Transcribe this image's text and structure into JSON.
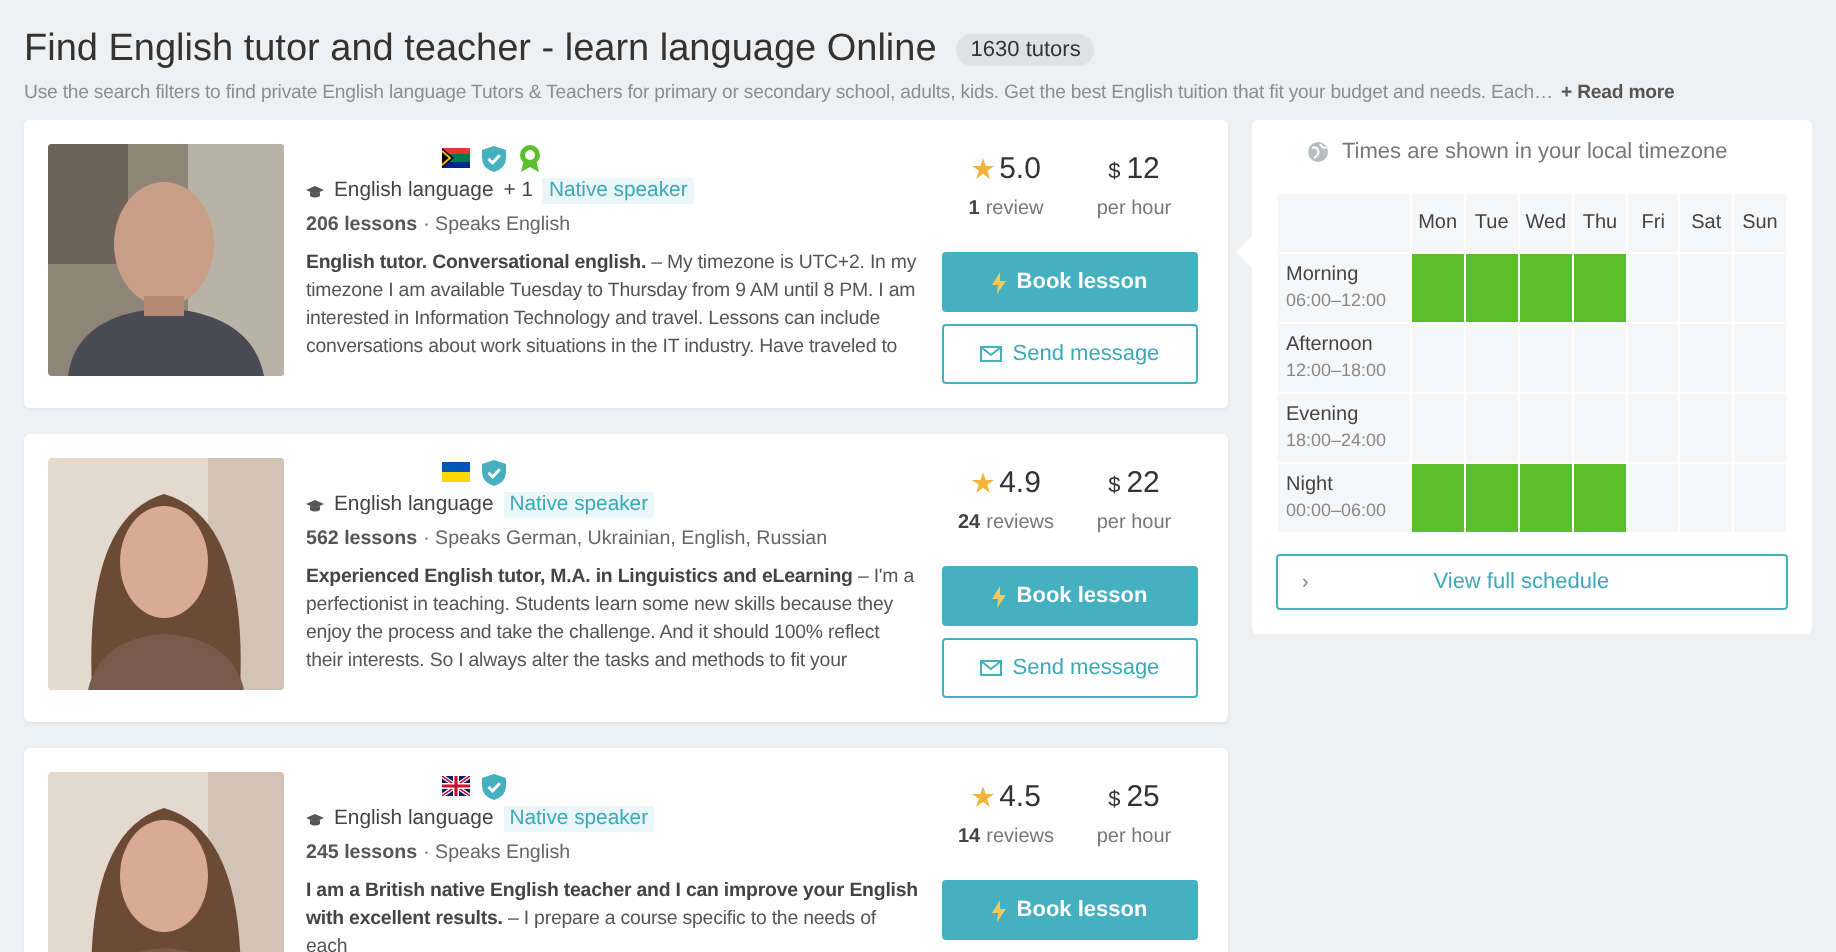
{
  "header": {
    "title": "Find English tutor and teacher - learn language Online",
    "count": "1630 tutors",
    "description": "Use the search filters to find private English language Tutors & Teachers for primary or secondary school, adults, kids. Get the best English tuition that fit your budget and needs. Each…",
    "read_more": "+ Read more"
  },
  "tutors": [
    {
      "photo": {
        "kind": "picture"
      },
      "badges": [
        {
          "kind": "flag_za"
        },
        {
          "kind": "verified"
        },
        {
          "kind": "award"
        }
      ],
      "language": "English language",
      "extra_languages": "+ 1",
      "native": "Native speaker",
      "lessons": "206 lessons",
      "speaks": "· Speaks English",
      "description": "**English tutor. Conversational english.** – My timezone is UTC+2. In my timezone I am available Tuesday to Thursday from 9 AM until 8 PM. I am interested in Information Technology and travel. Lessons can include conversations about work situations in the IT industry. Have traveled to",
      "rating": "5.0",
      "reviews_count": "1",
      "reviews_label": "review",
      "currency": "$",
      "price": "12",
      "price_unit": "per hour",
      "book": "Book lesson",
      "message": "Send message"
    },
    {
      "photo": {
        "kind": "picture"
      },
      "badges": [
        {
          "kind": "flag_ua"
        },
        {
          "kind": "verified"
        }
      ],
      "language": "English language",
      "native": "Native speaker",
      "lessons": "562 lessons",
      "speaks": "· Speaks German, Ukrainian, English, Russian",
      "description": "**Experienced English tutor, M.A. in Linguistics and eLearning** – I'm a perfectionist in teaching. Students learn some new skills because they enjoy the process and take the challenge. And it should 100% reflect their interests. So I always alter the tasks and methods to fit your",
      "rating": "4.9",
      "reviews_count": "24",
      "reviews_label": "reviews",
      "currency": "$",
      "price": "22",
      "price_unit": "per hour",
      "book": "Book lesson",
      "message": "Send message"
    },
    {
      "photo": {
        "kind": "picture"
      },
      "badges": [
        {
          "kind": "flag_gb"
        },
        {
          "kind": "verified"
        }
      ],
      "language": "English language",
      "native": "Native speaker",
      "lessons": "245 lessons",
      "speaks": "· Speaks English",
      "description": "**I am a British native English teacher and I can improve your English with excellent results.** – I prepare a course specific to the needs of each",
      "rating": "4.5",
      "reviews_count": "14",
      "reviews_label": "reviews",
      "currency": "$",
      "price": "25",
      "price_unit": "per hour",
      "book": "Book lesson"
    }
  ],
  "schedule": {
    "note": "Times are shown in your local timezone",
    "days": [
      "Mon",
      "Tue",
      "Wed",
      "Thu",
      "Fri",
      "Sat",
      "Sun"
    ],
    "rows": [
      {
        "label": "Morning",
        "hours": "06:00–12:00",
        "cells": [
          {
            "available": true
          },
          {
            "available": true
          },
          {
            "available": true
          },
          {
            "available": true
          },
          {
            "available": false
          },
          {
            "available": false
          },
          {
            "available": false
          }
        ]
      },
      {
        "label": "Afternoon",
        "hours": "12:00–18:00",
        "cells": [
          {
            "available": false
          },
          {
            "available": false
          },
          {
            "available": false
          },
          {
            "available": false
          },
          {
            "available": false
          },
          {
            "available": false
          },
          {
            "available": false
          }
        ]
      },
      {
        "label": "Evening",
        "hours": "18:00–24:00",
        "cells": [
          {
            "available": false
          },
          {
            "available": false
          },
          {
            "available": false
          },
          {
            "available": false
          },
          {
            "available": false
          },
          {
            "available": false
          },
          {
            "available": false
          }
        ]
      },
      {
        "label": "Night",
        "hours": "00:00–06:00",
        "cells": [
          {
            "available": true
          },
          {
            "available": true
          },
          {
            "available": true
          },
          {
            "available": true
          },
          {
            "available": false
          },
          {
            "available": false
          },
          {
            "available": false
          }
        ]
      }
    ],
    "caret": "›",
    "button": "View full schedule"
  }
}
